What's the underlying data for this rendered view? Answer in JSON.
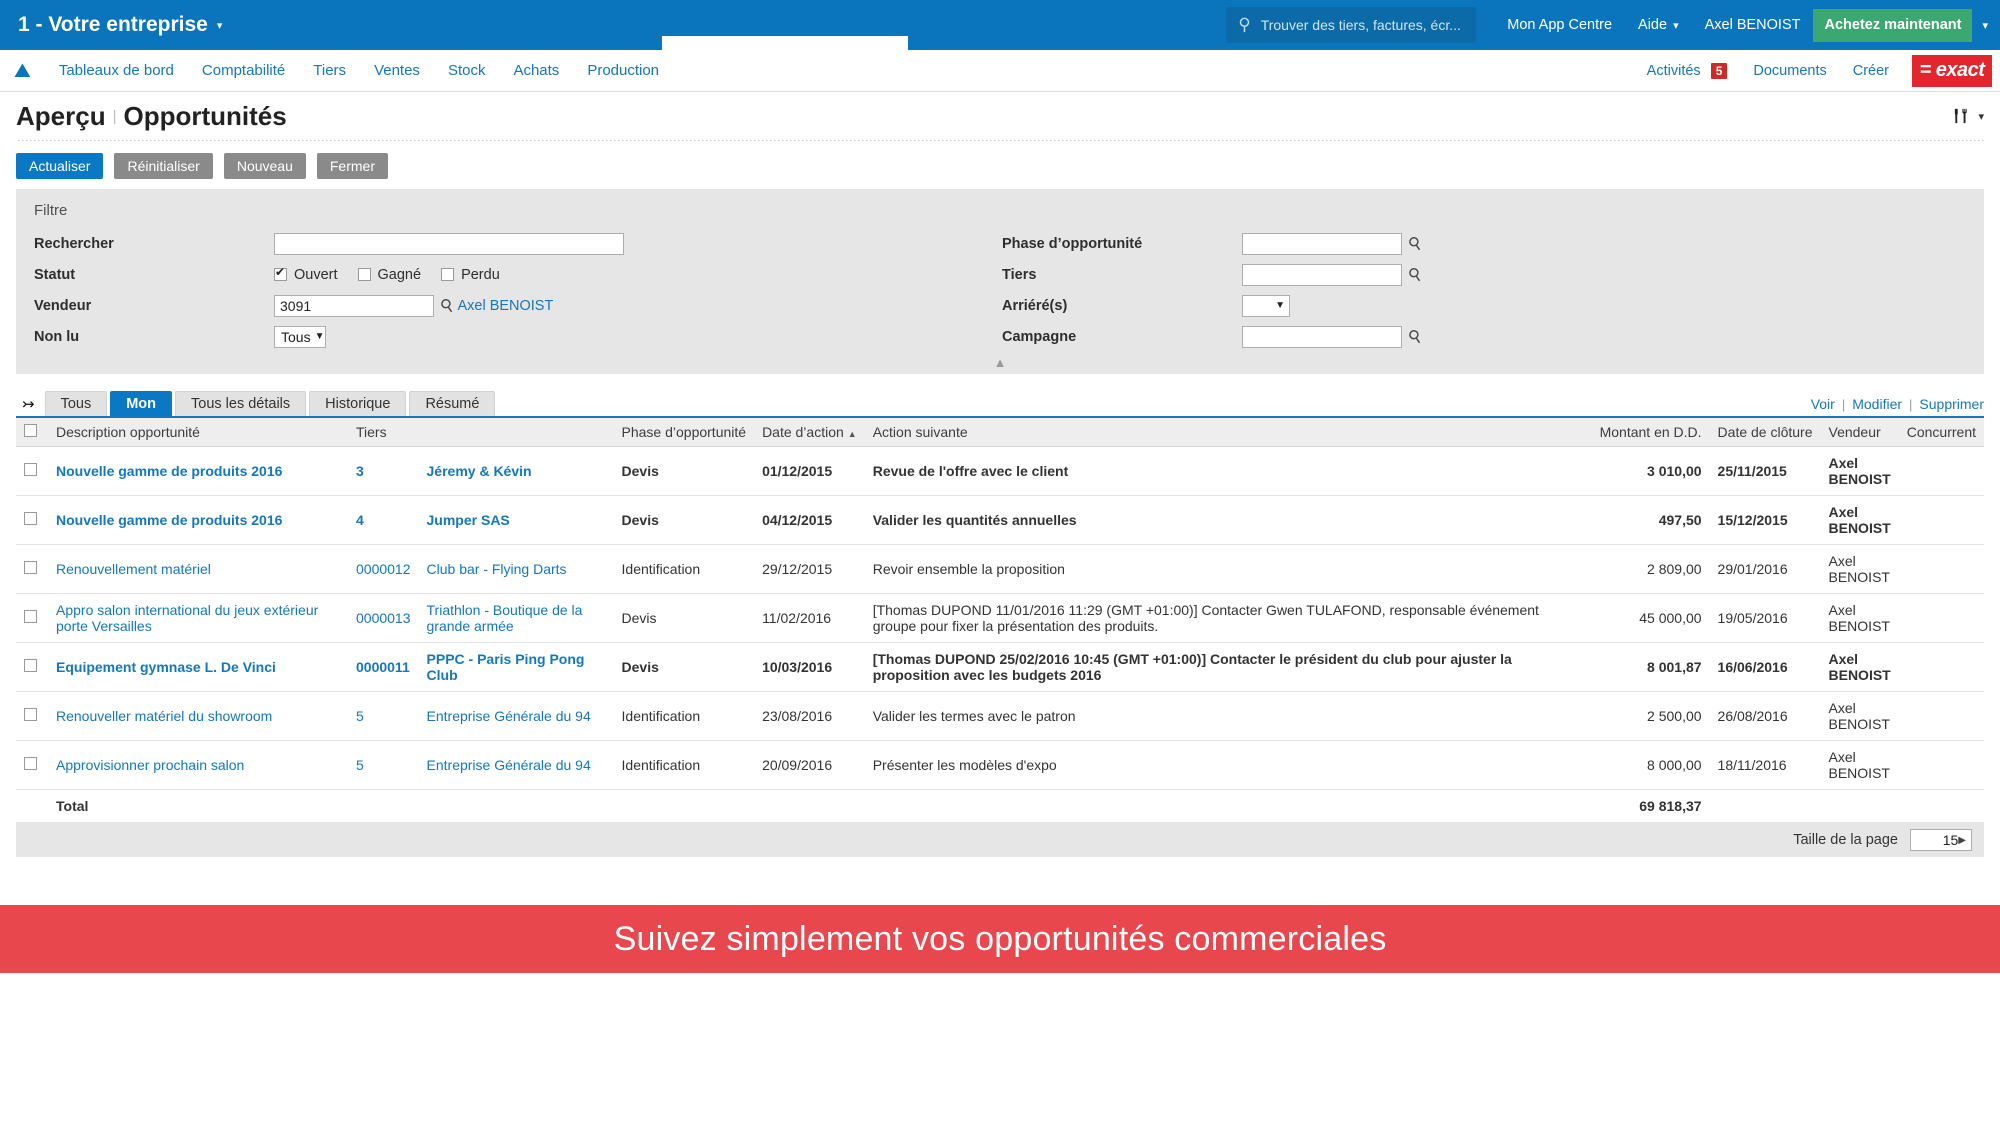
{
  "topbar": {
    "company": "1 - Votre entreprise",
    "company_caret": "chevron-down",
    "search_placeholder": "Trouver des tiers, factures, écr...",
    "links": [
      "Mon App Centre",
      "Aide"
    ],
    "user": "Axel BENOIST",
    "buy_button": "Achetez maintenant"
  },
  "navbar": {
    "items": [
      "Tableaux de bord",
      "Comptabilité",
      "Tiers",
      "Ventes",
      "Stock",
      "Achats",
      "Production"
    ],
    "right_items": [
      "Activités",
      "Documents",
      "Créer"
    ],
    "activity_count": "5",
    "logo_text": "= exact"
  },
  "page": {
    "title": "Aperçu",
    "separator": "|",
    "subtitle": "Opportunités"
  },
  "toolbar": {
    "refresh": "Actualiser",
    "reset": "Réinitialiser",
    "new": "Nouveau",
    "close": "Fermer"
  },
  "filter": {
    "title": "Filtre",
    "search_label": "Rechercher",
    "search_value": "",
    "status_label": "Statut",
    "status_options": [
      {
        "label": "Ouvert",
        "checked": true
      },
      {
        "label": "Gagné",
        "checked": false
      },
      {
        "label": "Perdu",
        "checked": false
      }
    ],
    "vendor_label": "Vendeur",
    "vendor_value": "3091",
    "vendor_name": "Axel BENOIST",
    "unread_label": "Non lu",
    "unread_value": "Tous",
    "phase_label": "Phase d’opportunité",
    "phase_value": "",
    "tiers_label": "Tiers",
    "tiers_value": "",
    "overdue_label": "Arriéré(s)",
    "overdue_value": "",
    "campaign_label": "Campagne",
    "campaign_value": ""
  },
  "tabs": {
    "items": [
      "Tous",
      "Mon",
      "Tous les détails",
      "Historique",
      "Résumé"
    ],
    "active": "Mon",
    "actions": [
      "Voir",
      "Modifier",
      "Supprimer"
    ]
  },
  "table": {
    "columns": [
      "Description opportunité",
      "Tiers",
      "Phase d’opportunité",
      "Date d’action",
      "Action suivante",
      "Montant en D.D.",
      "Date de clôture",
      "Vendeur",
      "Concurrent"
    ],
    "sorted_column": "Date d’action",
    "sort_direction": "asc",
    "rows": [
      {
        "description": "Nouvelle gamme de produits 2016",
        "tiers_id": "3",
        "tiers_name": "Jéremy & Kévin",
        "phase": "Devis",
        "action_date": "01/12/2015",
        "next_action": "Revue de l'offre avec le client",
        "amount": "3 010,00",
        "close_date": "25/11/2015",
        "vendor": "Axel BENOIST",
        "competitor": "",
        "unread": true
      },
      {
        "description": "Nouvelle gamme de produits 2016",
        "tiers_id": "4",
        "tiers_name": "Jumper SAS",
        "phase": "Devis",
        "action_date": "04/12/2015",
        "next_action": "Valider les quantités annuelles",
        "amount": "497,50",
        "close_date": "15/12/2015",
        "vendor": "Axel BENOIST",
        "competitor": "",
        "unread": true
      },
      {
        "description": "Renouvellement matériel",
        "tiers_id": "0000012",
        "tiers_name": "Club bar - Flying Darts",
        "phase": "Identification",
        "action_date": "29/12/2015",
        "next_action": "Revoir ensemble la proposition",
        "amount": "2 809,00",
        "close_date": "29/01/2016",
        "vendor": "Axel BENOIST",
        "competitor": "",
        "unread": false
      },
      {
        "description": "Appro salon international du jeux extérieur porte Versailles",
        "tiers_id": "0000013",
        "tiers_name": "Triathlon - Boutique de la grande armée",
        "phase": "Devis",
        "action_date": "11/02/2016",
        "next_action": "[Thomas DUPOND 11/01/2016 11:29 (GMT +01:00)] Contacter Gwen TULAFOND, responsable événement groupe pour fixer la présentation des produits.",
        "amount": "45 000,00",
        "close_date": "19/05/2016",
        "vendor": "Axel BENOIST",
        "competitor": "",
        "unread": false
      },
      {
        "description": "Equipement gymnase L. De Vinci",
        "tiers_id": "0000011",
        "tiers_name": "PPPC - Paris Ping Pong Club",
        "phase": "Devis",
        "action_date": "10/03/2016",
        "next_action": "[Thomas DUPOND 25/02/2016 10:45 (GMT +01:00)] Contacter le président du club pour ajuster la proposition avec les budgets 2016",
        "amount": "8 001,87",
        "close_date": "16/06/2016",
        "vendor": "Axel BENOIST",
        "competitor": "",
        "unread": true
      },
      {
        "description": "Renouveller matériel du showroom",
        "tiers_id": "5",
        "tiers_name": "Entreprise Générale du 94",
        "phase": "Identification",
        "action_date": "23/08/2016",
        "next_action": "Valider les termes avec le patron",
        "amount": "2 500,00",
        "close_date": "26/08/2016",
        "vendor": "Axel BENOIST",
        "competitor": "",
        "unread": false
      },
      {
        "description": "Approvisionner prochain salon",
        "tiers_id": "5",
        "tiers_name": "Entreprise Générale du 94",
        "phase": "Identification",
        "action_date": "20/09/2016",
        "next_action": "Présenter les modèles d'expo",
        "amount": "8 000,00",
        "close_date": "18/11/2016",
        "vendor": "Axel BENOIST",
        "competitor": "",
        "unread": false
      }
    ],
    "total_label": "Total",
    "total_amount": "69 818,37"
  },
  "pager": {
    "label": "Taille de la page",
    "value": "15"
  },
  "banner": {
    "text": "Suivez simplement vos opportunités commerciales",
    "color": "#e8474e"
  },
  "colors": {
    "brand_blue": "#0a75bc",
    "link_blue": "#1577bd",
    "exact_red": "#e1262d",
    "buy_green": "#3aa870",
    "badge_red": "#cf2a2a"
  }
}
